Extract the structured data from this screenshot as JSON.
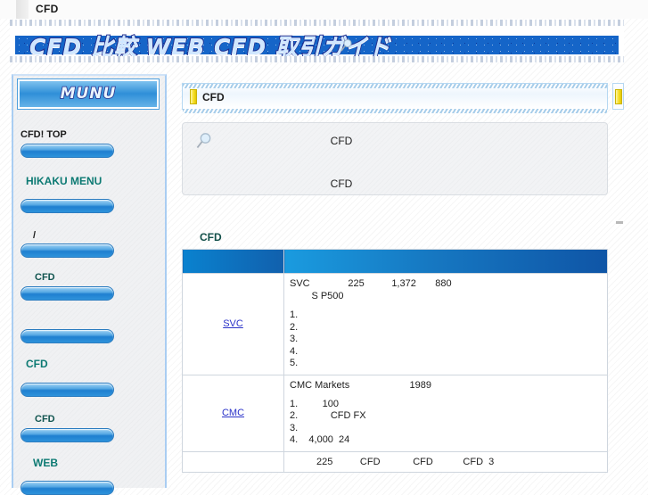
{
  "page": {
    "title": "CFD"
  },
  "banner": {
    "title": "CFD 比較 WEB CFD 取引ガイド",
    "magnifier_icon": "magnifier-icon",
    "blue": "#1565c8"
  },
  "sidebar": {
    "logo": "MUNU",
    "items": [
      {
        "label": "CFD!    TOP",
        "style": "dark"
      },
      {
        "label": "HIKAKU MENU",
        "style": "big"
      },
      {
        "label": "/",
        "style": "dark"
      },
      {
        "label": "CFD",
        "style": "normal"
      },
      {
        "label": "",
        "style": "normal"
      },
      {
        "label": "CFD",
        "style": "big"
      },
      {
        "label": "CFD",
        "style": "normal"
      },
      {
        "label": "WEB",
        "style": "big"
      }
    ]
  },
  "content": {
    "titlebar": {
      "title": "CFD"
    },
    "infobox": {
      "icon": "magnifier-icon",
      "line1": "CFD",
      "line2": "CFD"
    },
    "section_title": "CFD",
    "table": {
      "headers": [
        "",
        ""
      ],
      "rows": [
        {
          "name": "SVC",
          "head": "SVC              225          1,372       880",
          "sub": "        S P500",
          "list": [
            "1.",
            "2.",
            "3.",
            "4.",
            "5."
          ]
        },
        {
          "name": "CMC",
          "head": "CMC Markets                      1989",
          "sub": "",
          "list": [
            "1.         100",
            "2.            CFD FX",
            "3.",
            "4.    4,000  24"
          ]
        }
      ],
      "last_row": "225          CFD            CFD           CFD  3"
    }
  },
  "colors": {
    "accent_blue": "#1565c8",
    "link_blue": "#2b33c9",
    "teal_label": "#10544f",
    "yellow_marker": "#f7e02c"
  }
}
